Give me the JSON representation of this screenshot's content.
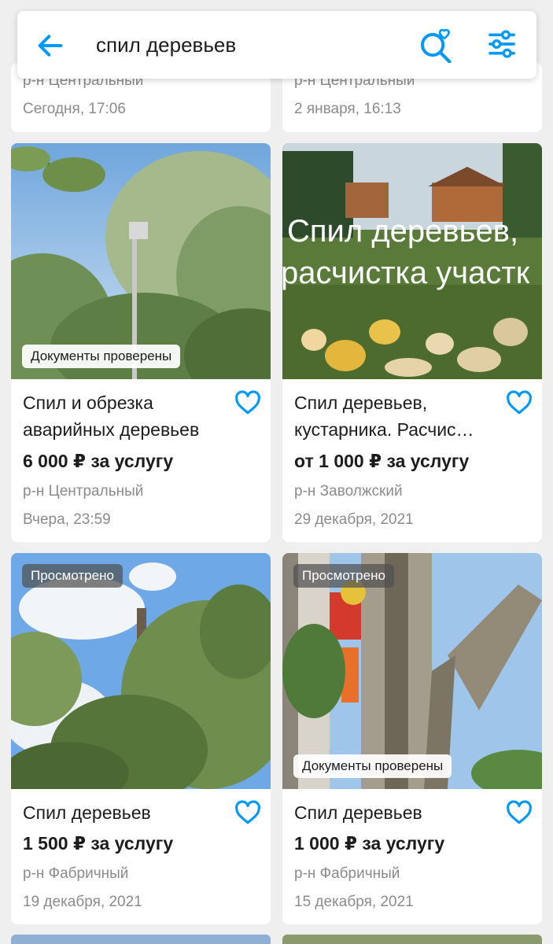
{
  "search": {
    "query": "спил деревьев"
  },
  "top_cards": [
    {
      "district": "р-н Центральный",
      "date": "Сегодня, 17:06"
    },
    {
      "district": "р-н Центральный",
      "date": "2 января, 16:13"
    }
  ],
  "cards": [
    {
      "badge": "Документы проверены",
      "title": "Спил и обрезка аварийных деревьев",
      "price": "6 000 ₽ за услугу",
      "district": "р-н Центральный",
      "date": "Вчера, 23:59"
    },
    {
      "image_text_1": "Спил деревьев,",
      "image_text_2": "расчистка участк",
      "title": "Спил деревьев, кустарника. Расчис…",
      "price": "от 1 000 ₽ за услугу",
      "district": "р-н Заволжский",
      "date": "29 декабря, 2021"
    },
    {
      "badge": "Просмотрено",
      "title": "Спил деревьев",
      "price": "1 500 ₽ за услугу",
      "district": "р-н Фабричный",
      "date": "19 декабря, 2021"
    },
    {
      "badge": "Просмотрено",
      "badge2": "Документы проверены",
      "title": "Спил деревьев",
      "price": "1 000 ₽ за услугу",
      "district": "р-н Фабричный",
      "date": "15 декабря, 2021"
    }
  ],
  "colors": {
    "accent": "#0099f7",
    "muted": "#8b8b8b",
    "text": "#1c1c1c",
    "background": "#efefef"
  },
  "icons": [
    "arrow-left-icon",
    "search-heart-icon",
    "sliders-icon",
    "heart-outline-icon"
  ]
}
